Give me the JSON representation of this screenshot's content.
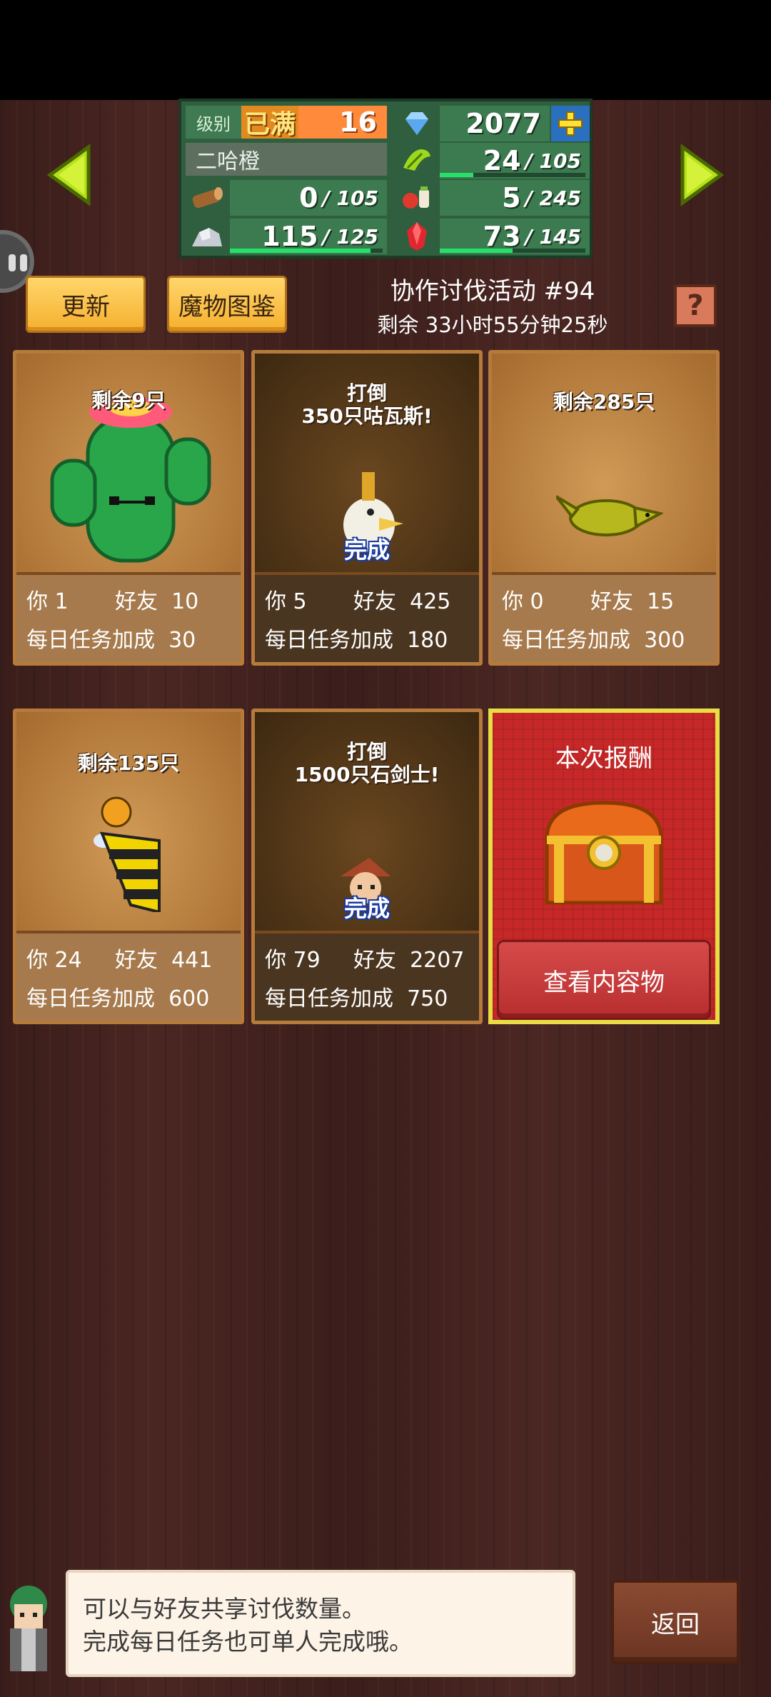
{
  "stats": {
    "level_label": "级别",
    "level_max": "已满",
    "level_value": "16",
    "gems": "2077",
    "player_name": "二哈橙",
    "grass": {
      "value": "24",
      "max": "105",
      "fill": 0.23
    },
    "wood": {
      "value": "0",
      "max": "105",
      "fill": 0.0
    },
    "food": {
      "value": "5",
      "max": "245",
      "fill": 0.02
    },
    "ore": {
      "value": "115",
      "max": "125",
      "fill": 0.92
    },
    "mana": {
      "value": "73",
      "max": "145",
      "fill": 0.5
    },
    "colors": {
      "panel": "#2f5f3e",
      "bar": "#27e06a",
      "accent": "#ff8a3c"
    }
  },
  "header": {
    "refresh_label": "更新",
    "dex_label": "魔物图鉴",
    "event_title": "协作讨伐活动 #94",
    "event_timer": "剩余 33小时55分钟25秒",
    "help_label": "?"
  },
  "labels": {
    "you": "你",
    "friend": "好友",
    "daily": "每日任务加成"
  },
  "cards": [
    {
      "title": "剩余9只",
      "done": "",
      "you": "1",
      "friends": "10",
      "daily": "30",
      "monster": "cactus-icon"
    },
    {
      "title": "打倒\n350只咕瓦斯!",
      "done": "完成",
      "you": "5",
      "friends": "425",
      "daily": "180",
      "monster": "bird-icon"
    },
    {
      "title": "剩余285只",
      "done": "",
      "you": "0",
      "friends": "15",
      "daily": "300",
      "monster": "lizard-icon"
    },
    {
      "title": "剩余135只",
      "done": "",
      "you": "24",
      "friends": "441",
      "daily": "600",
      "monster": "bee-icon"
    },
    {
      "title": "打倒\n1500只石剑士!",
      "done": "完成",
      "you": "79",
      "friends": "2207",
      "daily": "750",
      "monster": "swordsman-icon"
    }
  ],
  "reward": {
    "title": "本次报酬",
    "button": "查看内容物"
  },
  "footer": {
    "line1": "可以与好友共享讨伐数量。",
    "line2": "完成每日任务也可单人完成哦。",
    "back": "返回"
  }
}
